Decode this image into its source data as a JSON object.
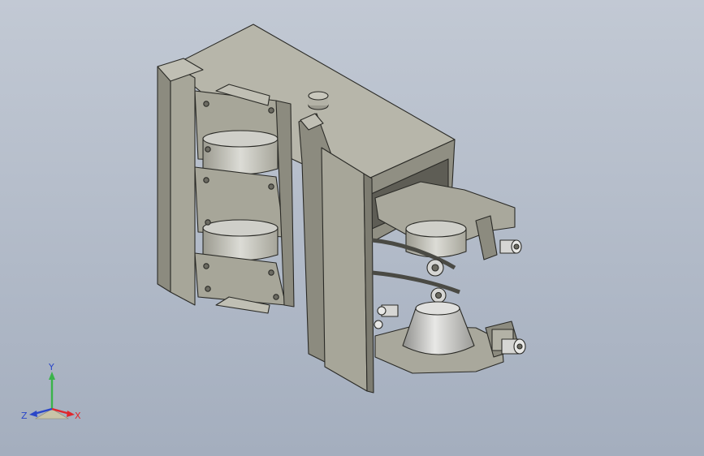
{
  "viewport": {
    "background_top": "#c2c9d4",
    "background_bottom": "#a4aebe"
  },
  "model": {
    "body_color": "#a7a699",
    "body_light": "#b3b2a6",
    "body_dark": "#8c8b7f",
    "edge_color": "#2a2a26",
    "metal_color": "#d6d6d4"
  },
  "triad": {
    "x_label": "X",
    "y_label": "Y",
    "z_label": "Z",
    "x_color": "#e0262c",
    "y_color": "#3ab34a",
    "z_color": "#2a46c8"
  }
}
